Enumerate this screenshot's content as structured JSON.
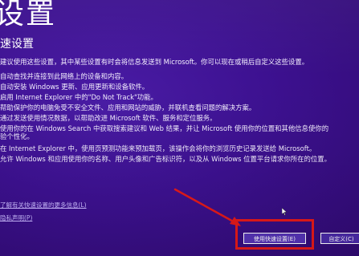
{
  "header": {
    "title": "设置",
    "section_title": "速设置"
  },
  "intro": "建议使用这些设置，其中某些设置有时会将信息发送到 Microsoft。你可以现在或稍后自定义这些设置。",
  "bullets": [
    "自动查找并连接到此网络上的设备和内容。",
    "自动安装 Windows 更新、应用更新和设备软件。",
    "启用 Internet Explorer 中的\"Do Not Track\"功能。",
    "帮助保护你的电脑免受不安全文件、应用和网站的威胁，并联机查看问题的解决方案。",
    "通过发送使用情况数据，以帮助改进 Microsoft 软件、服务和定位服务。",
    "使用你的在 Windows Search 中获取搜索建议和 Web 结果，并让 Microsoft 使用你的位置和其他信息使你的",
    "验个性化。",
    "在 Internet Explorer 中，使用页预测功能来预加载页，该操作会将你的浏览历史记录发送给 Microsoft。",
    "允许 Windows 和应用使用你的名称、用户头像和广告标识符，以及从 Windows 位置平台请求你所在的位置。"
  ],
  "links": {
    "learn_more": "了解有关快速设置的更多信息(L)",
    "privacy": "隐私声明(P)"
  },
  "buttons": {
    "express": "使用快速设置(E)",
    "customize": "自定义(C)"
  },
  "colors": {
    "background": "#3a0f86",
    "annotation": "#e51a1a"
  }
}
